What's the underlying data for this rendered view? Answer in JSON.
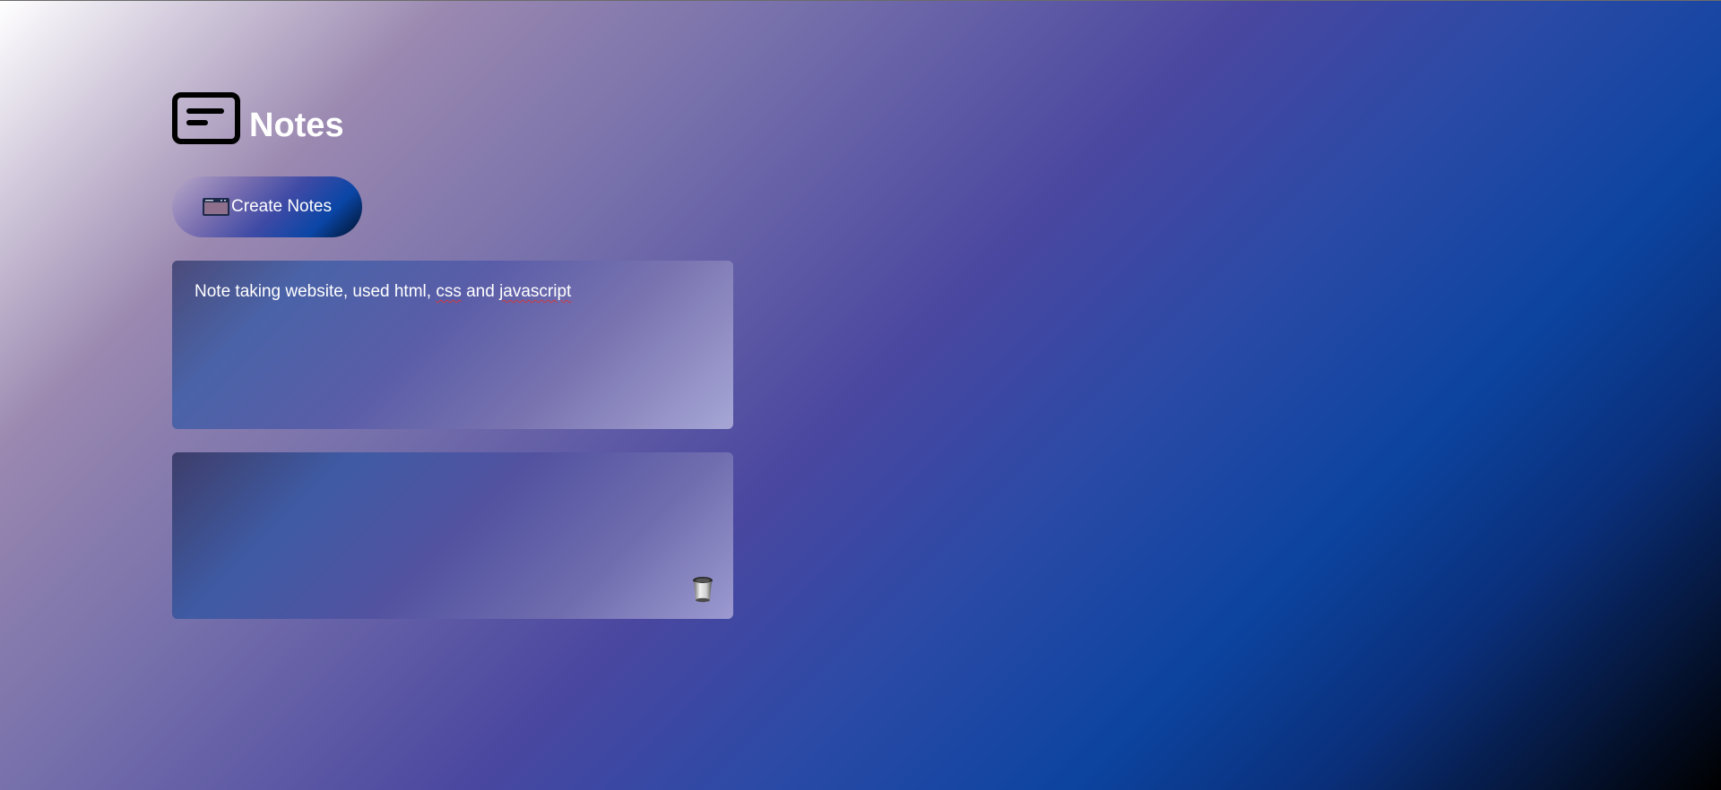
{
  "app": {
    "title": "Notes",
    "logo_icon": "notes-card-icon"
  },
  "toolbar": {
    "create_label": "Create Notes",
    "create_icon": "note-window-icon"
  },
  "notes": [
    {
      "text_before": "Note taking website, used html, ",
      "text_spell1": "css",
      "text_middle": " and ",
      "text_spell2": "javascript",
      "text_after": ""
    },
    {
      "text": "",
      "delete_icon": "trash-bin-icon"
    }
  ],
  "colors": {
    "title": "#ffffff",
    "misspell_underline": "#d23a3a"
  }
}
